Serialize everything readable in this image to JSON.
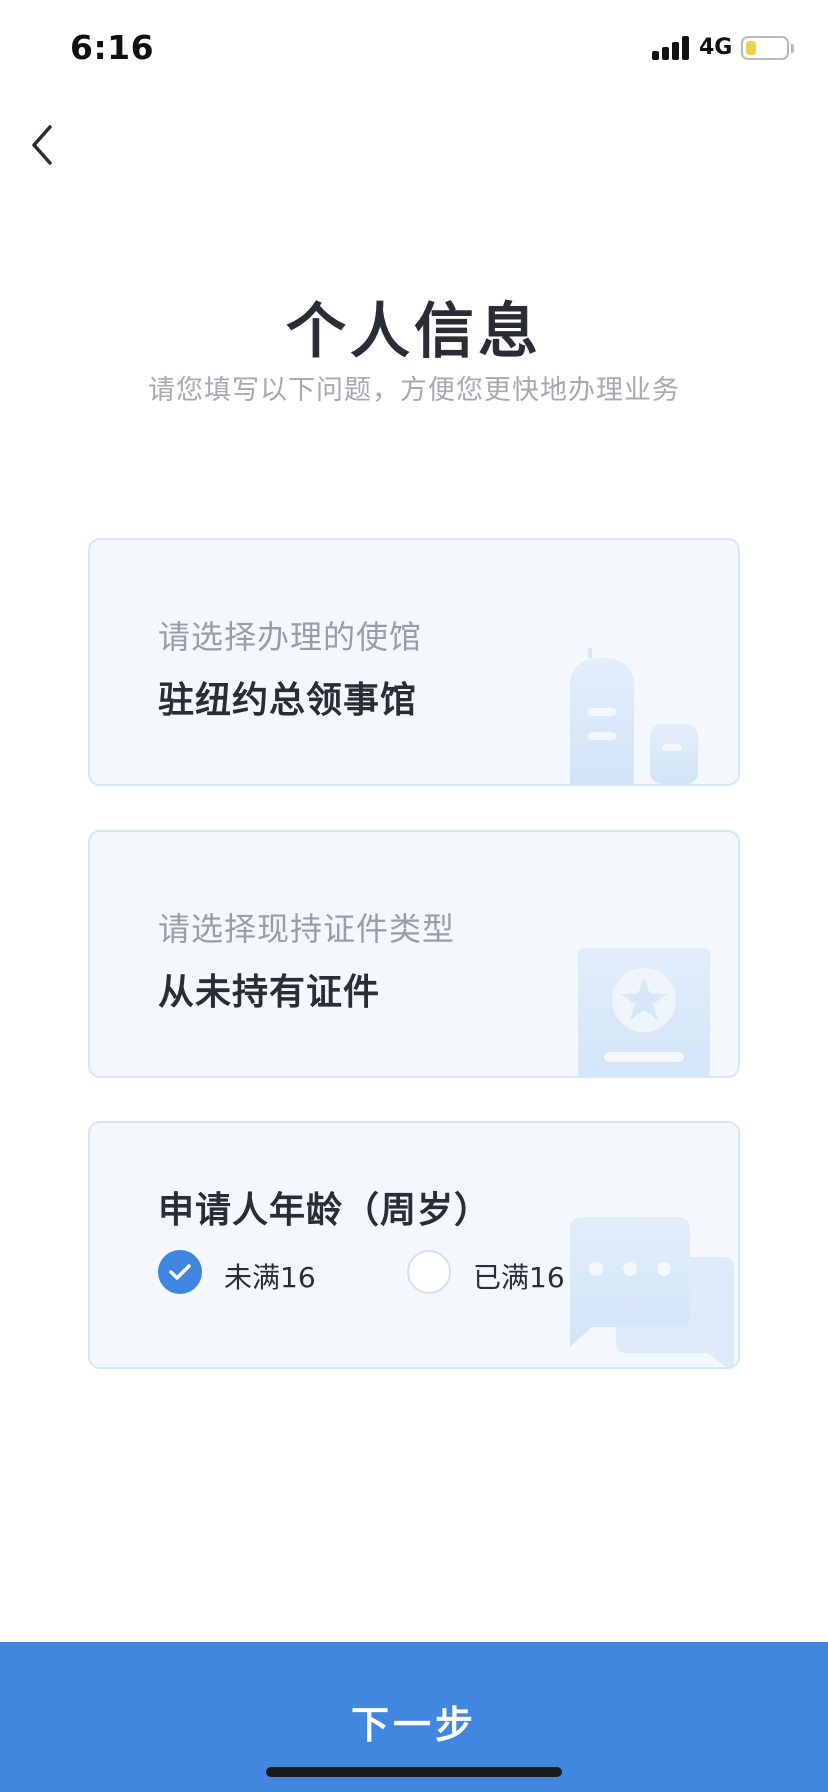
{
  "status_bar": {
    "time": "6:16",
    "network": "4G"
  },
  "nav": {
    "back_icon": "chevron-left-icon"
  },
  "header": {
    "title": "个人信息",
    "subtitle": "请您填写以下问题，方便您更快地办理业务"
  },
  "cards": {
    "consulate": {
      "label": "请选择办理的使馆",
      "value": "驻纽约总领事馆",
      "icon": "building-icon"
    },
    "document": {
      "label": "请选择现持证件类型",
      "value": "从未持有证件",
      "icon": "passport-icon"
    },
    "age": {
      "heading": "申请人年龄（周岁）",
      "icon": "chat-bubbles-icon",
      "options": [
        {
          "label": "未满16",
          "checked": true
        },
        {
          "label": "已满16",
          "checked": false
        }
      ]
    }
  },
  "footer": {
    "next_label": "下一步"
  },
  "colors": {
    "accent": "#4186df",
    "card_bg": "#f4f8fd",
    "card_border": "#d5e6f7"
  }
}
